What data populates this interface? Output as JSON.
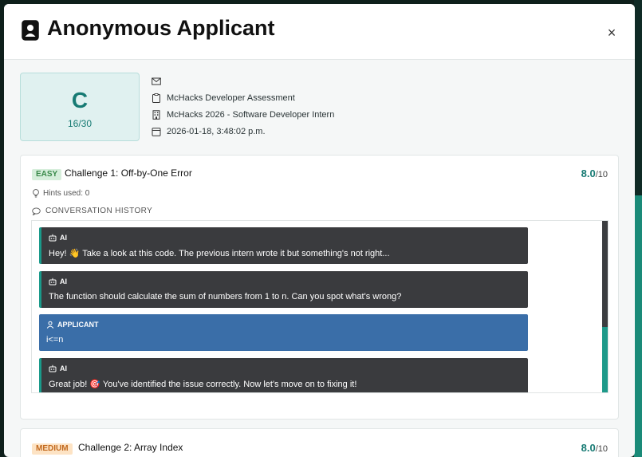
{
  "modal": {
    "title": "Anonymous Applicant",
    "close_label": "×"
  },
  "applicant": {
    "grade": "C",
    "score": "16/30",
    "email": "",
    "assessment": "McHacks Developer Assessment",
    "position": "McHacks 2026 - Software Developer Intern",
    "date": "2026-01-18, 3:48:02 p.m."
  },
  "challenges": [
    {
      "difficulty": "EASY",
      "title": "Challenge 1: Off-by-One Error",
      "score": "8.0",
      "out_of": "/10",
      "hints": "Hints used: 0",
      "conversation_label": "CONVERSATION HISTORY",
      "messages": [
        {
          "role": "AI",
          "text": "Hey! 👋 Take a look at this code. The previous intern wrote it but something's not right..."
        },
        {
          "role": "AI",
          "text": "The function should calculate the sum of numbers from 1 to n. Can you spot what's wrong?"
        },
        {
          "role": "APPLICANT",
          "text": "i<=n"
        },
        {
          "role": "AI",
          "text": "Great job! 🎯 You've identified the issue correctly. Now let's move on to fixing it!"
        }
      ]
    },
    {
      "difficulty": "MEDIUM",
      "title": "Challenge 2: Array Index",
      "score": "8.0",
      "out_of": "/10"
    }
  ],
  "colors": {
    "accent": "#167a73",
    "ai_bubble": "#3a3b3e",
    "applicant_bubble": "#3a6ea8",
    "easy_badge": "#d6eedb",
    "medium_badge": "#fde3c4"
  }
}
